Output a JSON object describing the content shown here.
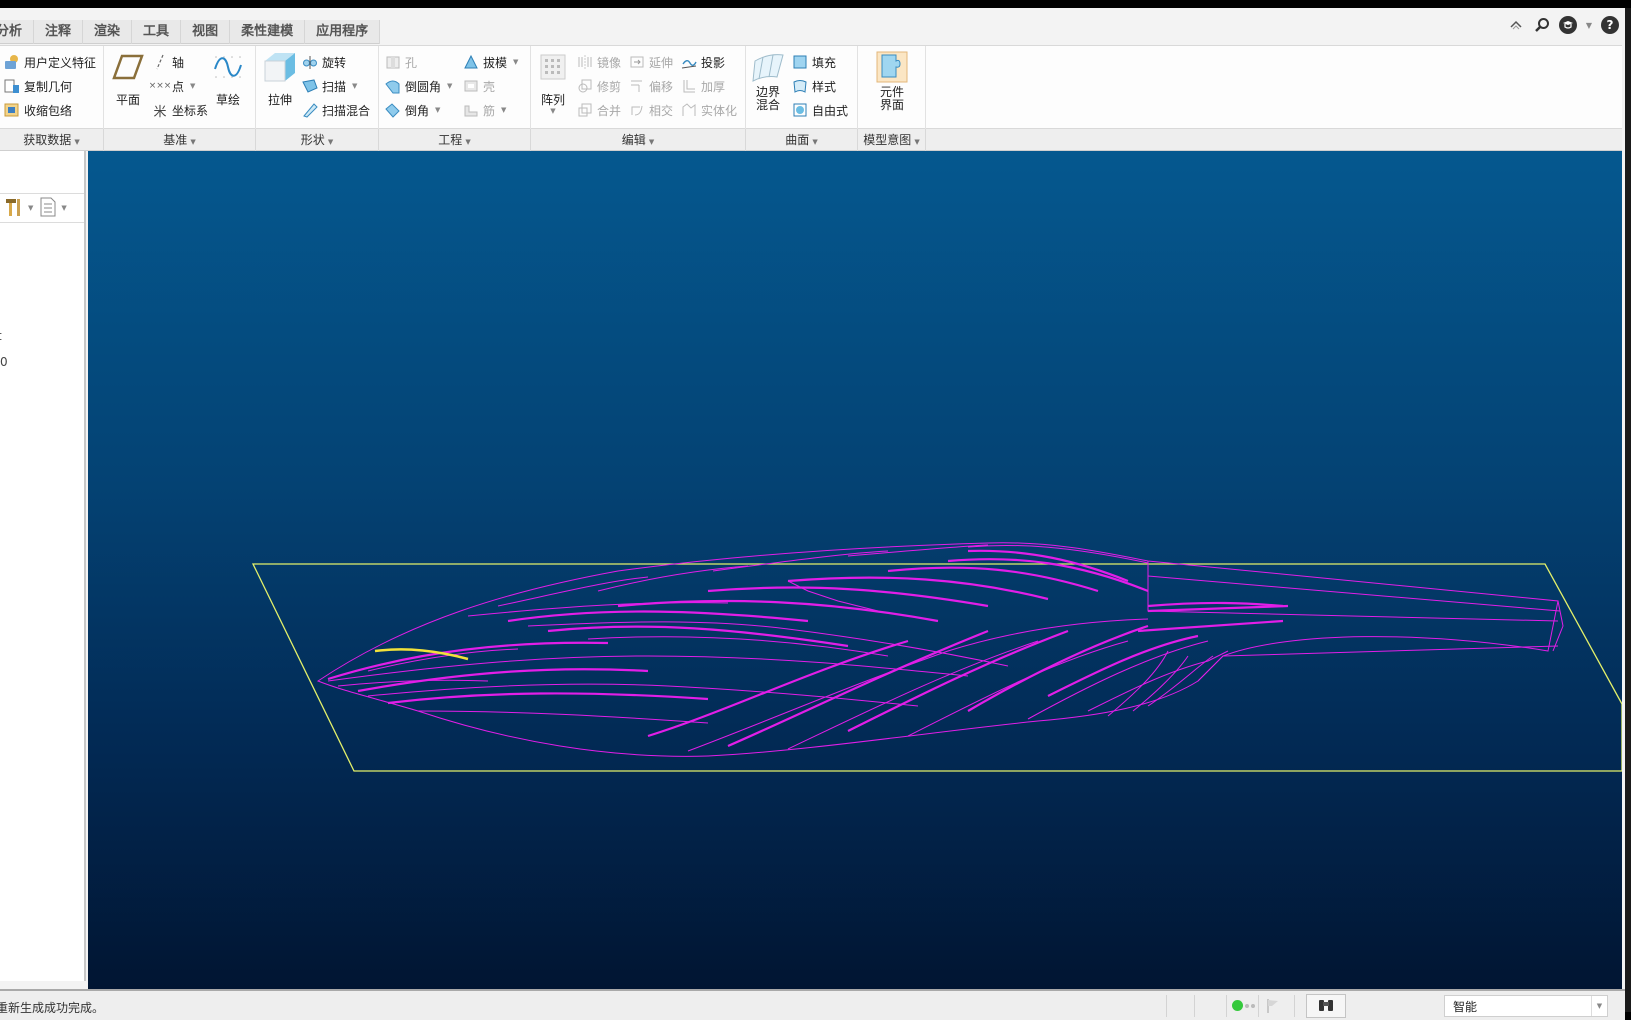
{
  "tabs": [
    "分析",
    "注释",
    "渲染",
    "工具",
    "视图",
    "柔性建模",
    "应用程序"
  ],
  "window_icons": [
    "collapse-ribbon-icon",
    "search-icon",
    "community-icon",
    "dropdown-icon",
    "help-icon"
  ],
  "ribbon": {
    "groups": [
      {
        "id": "get_data",
        "label": "获取数据",
        "items": [
          {
            "label": "用户定义特征",
            "icon": "udf-icon",
            "enabled": true
          },
          {
            "label": "复制几何",
            "icon": "copy-geometry-icon",
            "enabled": true
          },
          {
            "label": "收缩包络",
            "icon": "shrinkwrap-icon",
            "enabled": true
          }
        ]
      },
      {
        "id": "datum",
        "label": "基准",
        "large": [
          {
            "label": "平面",
            "icon": "datum-plane-icon"
          },
          {
            "label": "草绘",
            "icon": "sketch-icon"
          }
        ],
        "items": [
          {
            "label": "轴",
            "icon": "axis-icon",
            "enabled": true
          },
          {
            "label": "点",
            "icon": "point-icon",
            "enabled": true,
            "dropdown": true
          },
          {
            "label": "坐标系",
            "icon": "csys-icon",
            "enabled": true
          }
        ]
      },
      {
        "id": "shapes",
        "label": "形状",
        "large": [
          {
            "label": "拉伸",
            "icon": "extrude-icon"
          }
        ],
        "items": [
          {
            "label": "旋转",
            "icon": "revolve-icon",
            "enabled": true
          },
          {
            "label": "扫描",
            "icon": "sweep-icon",
            "enabled": true,
            "dropdown": true
          },
          {
            "label": "扫描混合",
            "icon": "swept-blend-icon",
            "enabled": true
          }
        ]
      },
      {
        "id": "engineering",
        "label": "工程",
        "items": [
          {
            "label": "孔",
            "icon": "hole-icon",
            "enabled": false
          },
          {
            "label": "倒圆角",
            "icon": "round-icon",
            "enabled": true,
            "dropdown": true
          },
          {
            "label": "倒角",
            "icon": "chamfer-icon",
            "enabled": true,
            "dropdown": true
          },
          {
            "label": "拔模",
            "icon": "draft-icon",
            "enabled": true,
            "dropdown": true
          },
          {
            "label": "壳",
            "icon": "shell-icon",
            "enabled": false
          },
          {
            "label": "筋",
            "icon": "rib-icon",
            "enabled": false,
            "dropdown": true
          }
        ]
      },
      {
        "id": "editing",
        "label": "编辑",
        "large": [
          {
            "label": "阵列",
            "icon": "pattern-icon",
            "dropdown": true
          }
        ],
        "items": [
          {
            "label": "镜像",
            "icon": "mirror-icon",
            "enabled": false
          },
          {
            "label": "修剪",
            "icon": "trim-icon",
            "enabled": false
          },
          {
            "label": "合并",
            "icon": "merge-icon",
            "enabled": false
          },
          {
            "label": "延伸",
            "icon": "extend-icon",
            "enabled": false
          },
          {
            "label": "偏移",
            "icon": "offset-icon",
            "enabled": false
          },
          {
            "label": "相交",
            "icon": "intersect-icon",
            "enabled": false
          },
          {
            "label": "投影",
            "icon": "project-icon",
            "enabled": true
          },
          {
            "label": "加厚",
            "icon": "thicken-icon",
            "enabled": false
          },
          {
            "label": "实体化",
            "icon": "solidify-icon",
            "enabled": false
          }
        ]
      },
      {
        "id": "surfaces",
        "label": "曲面",
        "large": [
          {
            "label": "边界\n混合",
            "icon": "boundary-blend-icon"
          }
        ],
        "items": [
          {
            "label": "填充",
            "icon": "fill-icon",
            "enabled": true
          },
          {
            "label": "样式",
            "icon": "style-icon",
            "enabled": true
          },
          {
            "label": "自由式",
            "icon": "freestyle-icon",
            "enabled": true
          }
        ]
      },
      {
        "id": "model_intent",
        "label": "模型意图",
        "large": [
          {
            "label": "元件\n界面",
            "icon": "component-interface-icon"
          }
        ]
      }
    ]
  },
  "left_panel": {
    "tools": [
      {
        "icon": "settings-tools-icon",
        "dropdown": true
      },
      {
        "icon": "show-list-icon",
        "dropdown": true
      }
    ],
    "partial_texts": [
      "t",
      "0"
    ]
  },
  "viewport": {
    "background_top": "#05588f",
    "background_bottom": "#011532",
    "datum_plane_color": "#e3f06a",
    "wireframe_color": "#e21ee8",
    "highlight_color": "#f2e23a"
  },
  "status": {
    "message": "重新生成成功完成。",
    "filter_value": "智能",
    "regen_status_color": "#35c93c"
  }
}
